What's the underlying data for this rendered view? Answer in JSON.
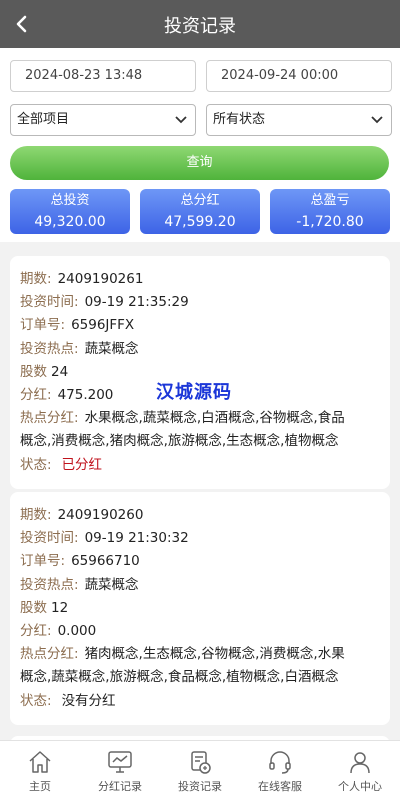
{
  "header": {
    "title": "投资记录",
    "back_icon": "chevron-left-icon"
  },
  "filters": {
    "start_date": "2024-08-23 13:48",
    "end_date": "2024-09-24 00:00",
    "project_select": "全部项目",
    "status_select": "所有状态",
    "query_label": "查询"
  },
  "stats": [
    {
      "label": "总投资",
      "value": "49,320.00"
    },
    {
      "label": "总分红",
      "value": "47,599.20"
    },
    {
      "label": "总盈亏",
      "value": "-1,720.80"
    }
  ],
  "labels": {
    "period": "期数:",
    "time": "投资时间:",
    "order": "订单号:",
    "hot": "投资热点:",
    "shares": "股数",
    "dividend": "分红:",
    "hot_dividend": "热点分红:",
    "status": "状态:"
  },
  "records": [
    {
      "period": "2409190261",
      "time": "09-19 21:35:29",
      "order": "6596JFFX",
      "hot": "蔬菜概念",
      "shares": "24",
      "dividend": "475.200",
      "hot_dividend_line1": "水果概念,蔬菜概念,白酒概念,谷物概念,食品",
      "hot_dividend_line2": "概念,消费概念,猪肉概念,旅游概念,生态概念,植物概念",
      "status": "已分红",
      "status_color": "#c0121c"
    },
    {
      "period": "2409190260",
      "time": "09-19 21:30:32",
      "order": "65966710",
      "hot": "蔬菜概念",
      "shares": "12",
      "dividend": "0.000",
      "hot_dividend_line1": "猪肉概念,生态概念,谷物概念,消费概念,水果",
      "hot_dividend_line2": "概念,蔬菜概念,旅游概念,食品概念,植物概念,白酒概念",
      "status": "没有分红",
      "status_color": "#222222"
    }
  ],
  "watermark": "汉城源码",
  "tabbar": [
    {
      "label": "主页",
      "icon": "home-icon"
    },
    {
      "label": "分红记录",
      "icon": "chart-monitor-icon"
    },
    {
      "label": "投资记录",
      "icon": "document-coins-icon"
    },
    {
      "label": "在线客服",
      "icon": "headset-icon"
    },
    {
      "label": "个人中心",
      "icon": "user-icon"
    }
  ]
}
